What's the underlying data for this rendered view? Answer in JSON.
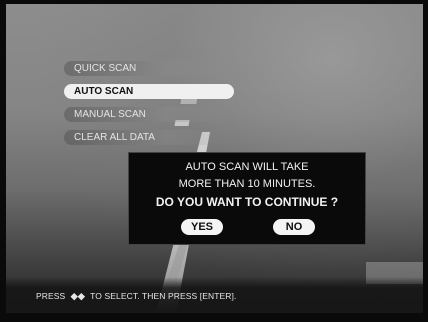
{
  "menu": {
    "items": [
      {
        "label": "QUICK SCAN"
      },
      {
        "label": "AUTO SCAN"
      },
      {
        "label": "MANUAL SCAN"
      },
      {
        "label": "CLEAR ALL DATA"
      }
    ],
    "selected": "AUTO SCAN"
  },
  "dialog": {
    "line1": "AUTO SCAN WILL TAKE",
    "line2": "MORE THAN 10 MINUTES.",
    "question": "DO YOU WANT TO CONTINUE ?",
    "yes_label": "YES",
    "no_label": "NO"
  },
  "footer": {
    "prefix": "PRESS",
    "arrows": "◆◆",
    "suffix": "TO SELECT. THEN PRESS [ENTER]."
  }
}
